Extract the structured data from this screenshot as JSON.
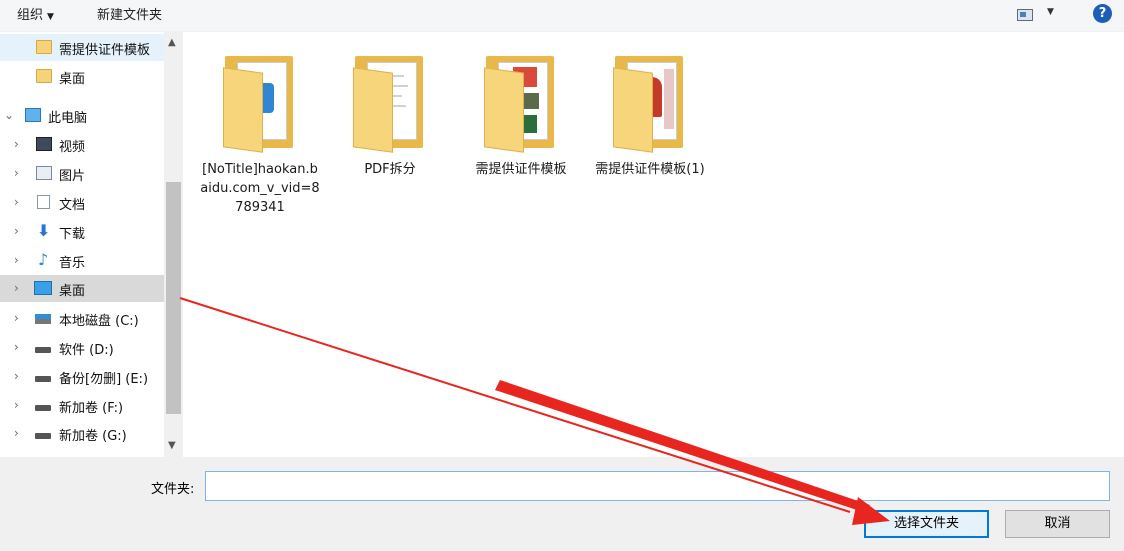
{
  "toolbar": {
    "organize": "组织",
    "new_folder": "新建文件夹",
    "help": "?"
  },
  "nav": {
    "items": [
      {
        "label": "需提供证件模板",
        "icon": "folder-icon"
      },
      {
        "label": "桌面",
        "icon": "folder-icon"
      },
      {
        "label": "此电脑",
        "icon": "computer-icon"
      },
      {
        "label": "视频",
        "icon": "video-icon"
      },
      {
        "label": "图片",
        "icon": "pictures-icon"
      },
      {
        "label": "文档",
        "icon": "document-icon"
      },
      {
        "label": "下载",
        "icon": "download-icon"
      },
      {
        "label": "音乐",
        "icon": "music-icon"
      },
      {
        "label": "桌面",
        "icon": "desktop-icon"
      },
      {
        "label": "本地磁盘 (C:)",
        "icon": "system-drive-icon"
      },
      {
        "label": "软件 (D:)",
        "icon": "drive-icon"
      },
      {
        "label": "备份[勿删] (E:)",
        "icon": "drive-icon"
      },
      {
        "label": "新加卷 (F:)",
        "icon": "drive-icon"
      },
      {
        "label": "新加卷 (G:)",
        "icon": "drive-icon"
      }
    ]
  },
  "files": [
    {
      "name": "[NoTitle]haokan.baidu.com_v_vid=8789341"
    },
    {
      "name": "PDF拆分"
    },
    {
      "name": "需提供证件模板"
    },
    {
      "name": "需提供证件模板(1)"
    }
  ],
  "footer": {
    "folder_label": "文件夹:",
    "folder_value": "",
    "select_button": "选择文件夹",
    "cancel_button": "取消"
  },
  "colors": {
    "accent": "#0078d7",
    "annotation_arrow": "#e8261f"
  }
}
